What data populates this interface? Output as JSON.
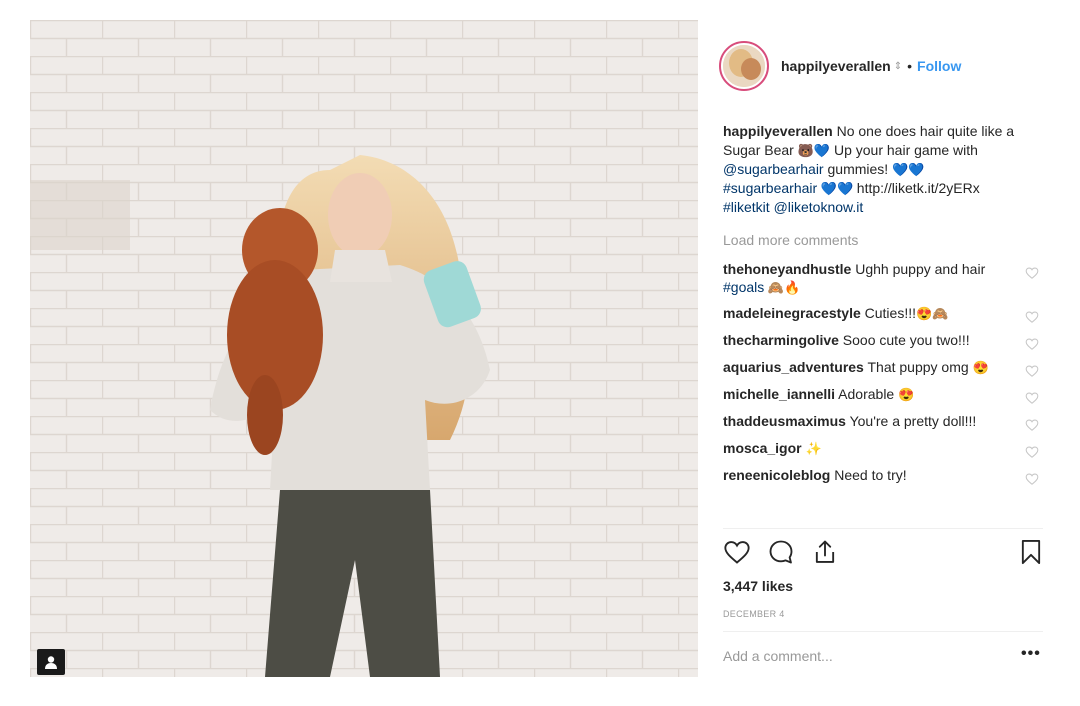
{
  "post": {
    "username": "happilyeverallen",
    "follow_label": "Follow",
    "separator": "•",
    "verified_glyph": "⇕",
    "caption": {
      "author": "happilyeverallen",
      "text_1": " No one does hair quite like a Sugar Bear ",
      "emoji_1": "🐻💙",
      "text_2": " Up your hair game with ",
      "mention_1": "@sugarbearhair",
      "text_3": " gummies! ",
      "emoji_2": "💙💙",
      "hashtag_1": "#sugarbearhair",
      "emoji_3": " 💙💙 ",
      "url": "http://liketk.it/2yERx",
      "hashtag_2": "#liketkit",
      "mention_2": "@liketoknow.it"
    },
    "load_more_label": "Load more comments",
    "comments": [
      {
        "user": "thehoneyandhustle",
        "text": " Ughh puppy and hair ",
        "tag": "#goals",
        "emoji": " 🙈🔥"
      },
      {
        "user": "madeleinegracestyle",
        "text": " Cuties!!!",
        "tag": "",
        "emoji": "😍🙈"
      },
      {
        "user": "thecharmingolive",
        "text": " Sooo cute you two!!!",
        "tag": "",
        "emoji": ""
      },
      {
        "user": "aquarius_adventures",
        "text": " That puppy omg ",
        "tag": "",
        "emoji": "😍"
      },
      {
        "user": "michelle_iannelli",
        "text": " Adorable ",
        "tag": "",
        "emoji": "😍"
      },
      {
        "user": "thaddeusmaximus",
        "text": " You're a pretty doll!!!",
        "tag": "",
        "emoji": ""
      },
      {
        "user": "mosca_igor",
        "text": " ",
        "tag": "",
        "emoji": "✨"
      },
      {
        "user": "reneenicoleblog",
        "text": " Need to try!",
        "tag": "",
        "emoji": ""
      }
    ],
    "likes": "3,447 likes",
    "date": "DECEMBER 4",
    "comment_placeholder": "Add a comment...",
    "more_label": "•••"
  },
  "icons": {
    "like": "heart-icon",
    "comment": "comment-icon",
    "share": "share-icon",
    "save": "bookmark-icon",
    "tag": "user-tag-icon"
  },
  "colors": {
    "follow": "#3897f0",
    "link": "#003569",
    "muted": "#999999",
    "avatar_ring": "#d84d7c"
  }
}
